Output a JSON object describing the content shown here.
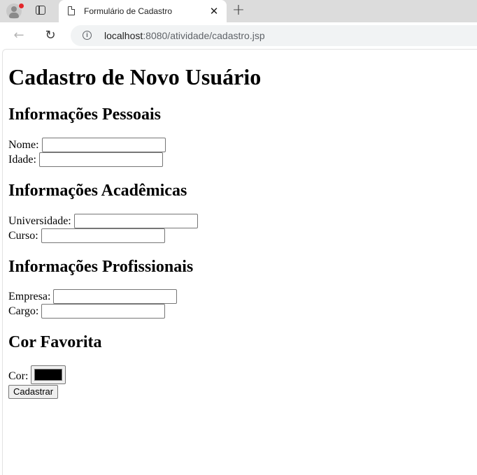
{
  "browser": {
    "tab_title": "Formulário de Cadastro",
    "url_host": "localhost",
    "url_rest": ":8080/atividade/cadastro.jsp"
  },
  "page": {
    "title": "Cadastro de Novo Usuário",
    "sections": {
      "pessoais": {
        "heading": "Informações Pessoais",
        "nome_label": "Nome:",
        "nome_value": "",
        "idade_label": "Idade:",
        "idade_value": ""
      },
      "academicas": {
        "heading": "Informações Acadêmicas",
        "universidade_label": "Universidade:",
        "universidade_value": "",
        "curso_label": "Curso:",
        "curso_value": ""
      },
      "profissionais": {
        "heading": "Informações Profissionais",
        "empresa_label": "Empresa:",
        "empresa_value": "",
        "cargo_label": "Cargo:",
        "cargo_value": ""
      },
      "cor": {
        "heading": "Cor Favorita",
        "cor_label": "Cor:",
        "cor_value": "#000000"
      }
    },
    "submit_label": "Cadastrar"
  },
  "icons": [
    "profile-icon",
    "tab-actions-icon",
    "document-icon",
    "close-icon",
    "new-tab-icon",
    "back-icon",
    "reload-icon",
    "site-info-icon"
  ]
}
